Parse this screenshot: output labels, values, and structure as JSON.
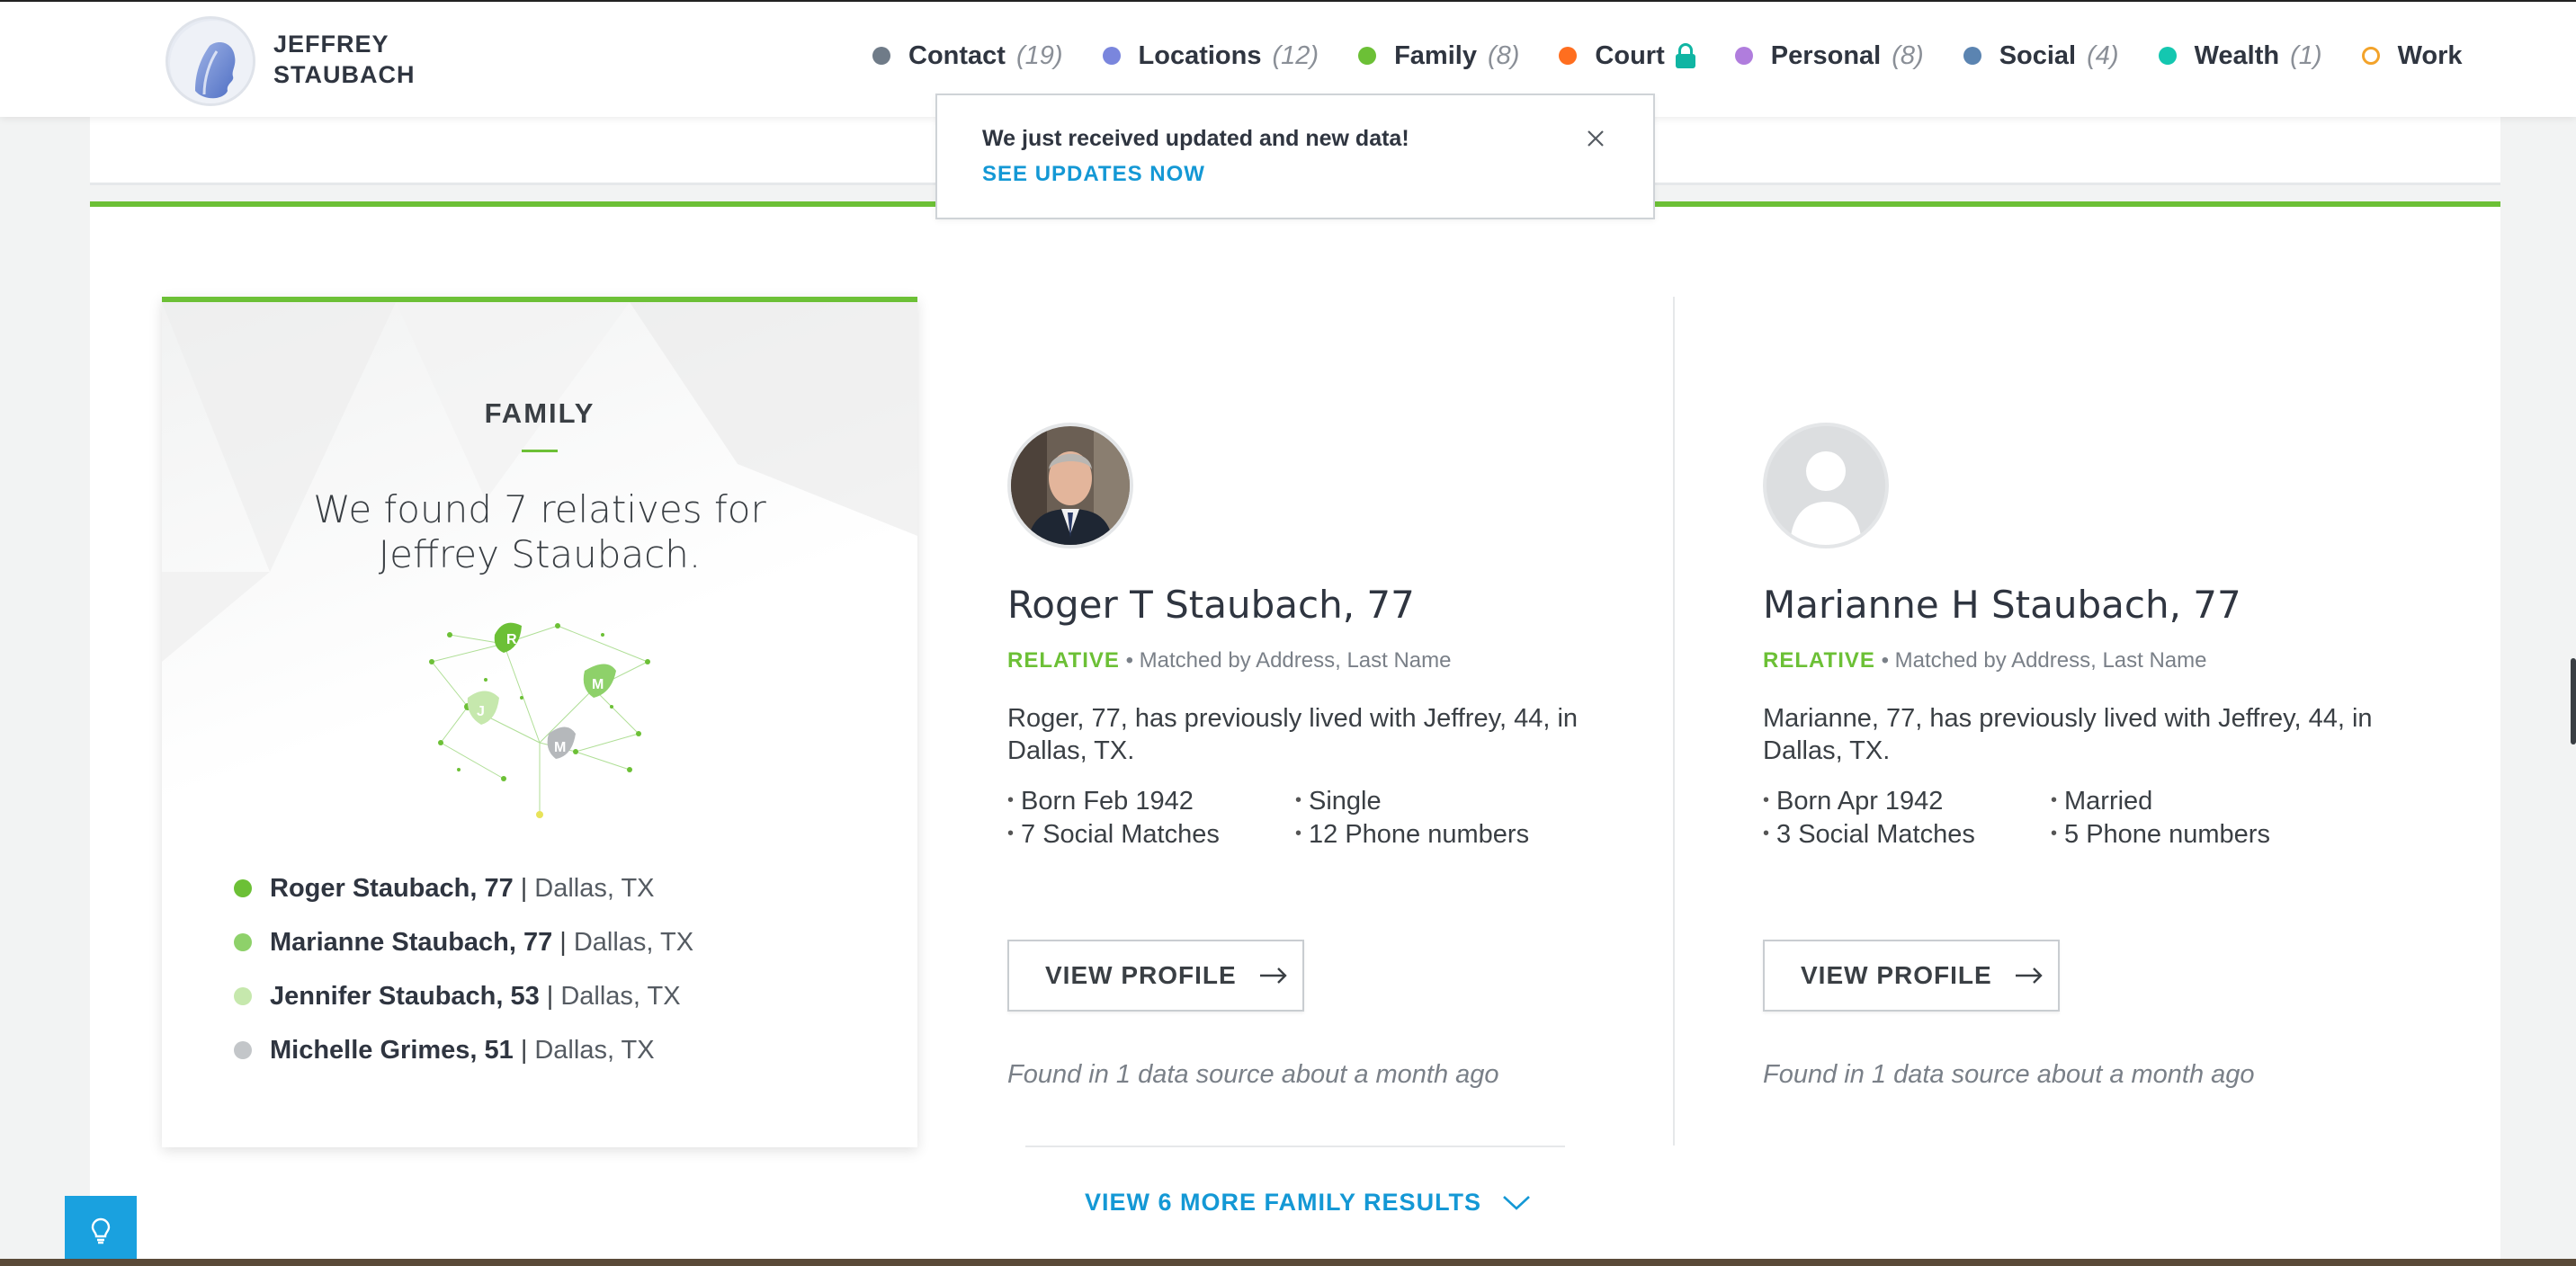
{
  "header": {
    "profile_name_line1": "JEFFREY",
    "profile_name_line2": "STAUBACH",
    "nav": [
      {
        "label": "Contact",
        "count": "(19)",
        "color": "#6f7b88"
      },
      {
        "label": "Locations",
        "count": "(12)",
        "color": "#7a86dd"
      },
      {
        "label": "Family",
        "count": "(8)",
        "color": "#6cc036"
      },
      {
        "label": "Court",
        "count": "",
        "color": "#ff6e1f",
        "locked": true
      },
      {
        "label": "Personal",
        "count": "(8)",
        "color": "#b07ddd"
      },
      {
        "label": "Social",
        "count": "(4)",
        "color": "#5b84b1"
      },
      {
        "label": "Wealth",
        "count": "(1)",
        "color": "#14c7b0"
      },
      {
        "label": "Work",
        "count": "",
        "color": "#f3a32a",
        "hollow": true
      }
    ]
  },
  "notice": {
    "message": "We just received updated and new data!",
    "link": "SEE UPDATES NOW"
  },
  "family": {
    "title": "FAMILY",
    "headline": "We found 7 relatives for Jeffrey Staubach.",
    "tree_letters": [
      "R",
      "M",
      "J",
      "M"
    ],
    "relatives": [
      {
        "name": "Roger Staubach, 77",
        "location": "Dallas, TX",
        "color": "#6cc036"
      },
      {
        "name": "Marianne Staubach, 77",
        "location": "Dallas, TX",
        "color": "#8ed16a"
      },
      {
        "name": "Jennifer Staubach, 53",
        "location": "Dallas, TX",
        "color": "#c6e8ad"
      },
      {
        "name": "Michelle Grimes, 51",
        "location": "Dallas, TX",
        "color": "#c3c6c9"
      }
    ]
  },
  "people": [
    {
      "name": "Roger T Staubach, 77",
      "tag": "RELATIVE",
      "matched": "Matched by Address, Last Name",
      "description": "Roger, 77, has previously lived with Jeffrey, 44, in Dallas, TX.",
      "facts": [
        "Born Feb 1942",
        "Single",
        "7 Social Matches",
        "12 Phone numbers"
      ],
      "button": "VIEW PROFILE",
      "found": "Found in 1 data source about a month ago"
    },
    {
      "name": "Marianne H Staubach, 77",
      "tag": "RELATIVE",
      "matched": "Matched by Address, Last Name",
      "description": "Marianne, 77, has previously lived with Jeffrey, 44, in Dallas, TX.",
      "facts": [
        "Born Apr 1942",
        "Married",
        "3 Social Matches",
        "5 Phone numbers"
      ],
      "button": "VIEW PROFILE",
      "found": "Found in 1 data source about a month ago"
    }
  ],
  "more_link": "VIEW 6 MORE FAMILY RESULTS"
}
